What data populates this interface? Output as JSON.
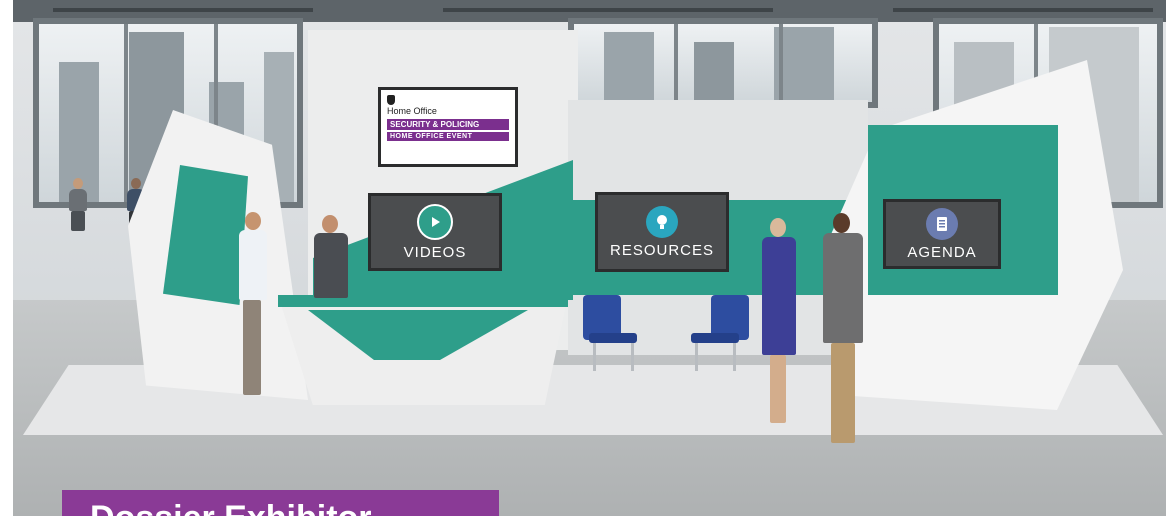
{
  "logo_screen": {
    "org": "Home Office",
    "line1": "SECURITY & POLICING",
    "line2": "HOME OFFICE EVENT"
  },
  "screens": [
    {
      "label": "VIDEOS",
      "icon": "play-icon",
      "accent": "#2e9e8a"
    },
    {
      "label": "RESOURCES",
      "icon": "lightbulb-icon",
      "accent": "#2aa6bf"
    },
    {
      "label": "AGENDA",
      "icon": "notebook-icon",
      "accent": "#6b7cb0"
    }
  ],
  "banner": {
    "title": "Dossier Exhibitor",
    "color": "#8a3a96"
  },
  "colors": {
    "teal": "#2e9e8a",
    "chair_blue": "#2d4da0"
  }
}
